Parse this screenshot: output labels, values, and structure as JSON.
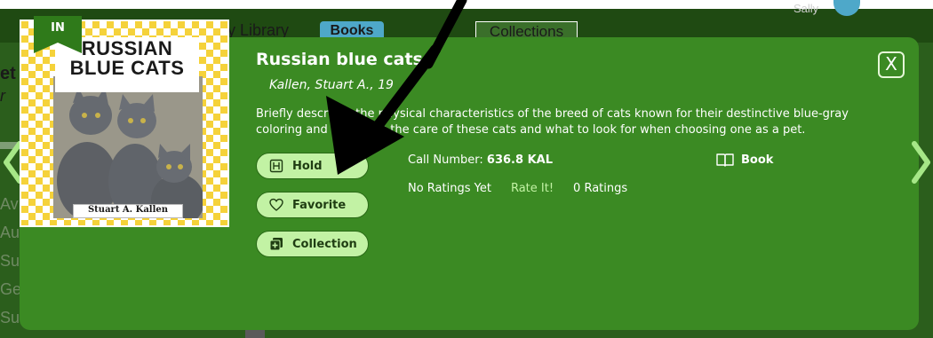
{
  "background": {
    "library_label": "y Library",
    "books_tab": "Books",
    "collections_tab": "Collections",
    "user_name": "Sally",
    "left_tag_1": "et",
    "left_tag_2": "r",
    "left_letters": [
      "Av",
      "Au",
      "Su",
      "Ge",
      "Su"
    ]
  },
  "modal": {
    "close_label": "X",
    "availability_badge": "IN",
    "cover": {
      "title": "RUSSIAN BLUE CATS",
      "author": "Stuart A. Kallen"
    },
    "title": "Russian blue cats",
    "author": "Kallen, Stuart A., 19",
    "description": "Briefly describes the physical characteristics of the breed of cats known for their destinctive blue-gray coloring and discusses the care of these cats and what to look for when choosing one as a pet.",
    "actions": {
      "hold": "Hold",
      "favorite": "Favorite",
      "collection": "Collection"
    },
    "call_number_label": "Call Number:",
    "call_number_value": "636.8 KAL",
    "format": "Book",
    "ratings_status": "No Ratings Yet",
    "rate_it": "Rate It!",
    "ratings_count": "0 Ratings"
  },
  "icons": {
    "hold": "hold-book-icon",
    "favorite": "heart-icon",
    "collection": "plus-square-icon",
    "format": "open-book-icon",
    "nav_left": "chevron-left-icon",
    "nav_right": "chevron-right-icon"
  },
  "colors": {
    "modal_bg": "#3b8a23",
    "button_bg": "#c2f2a4",
    "page_bg": "#2b5e1c",
    "badge_green": "#2f7a1a"
  }
}
